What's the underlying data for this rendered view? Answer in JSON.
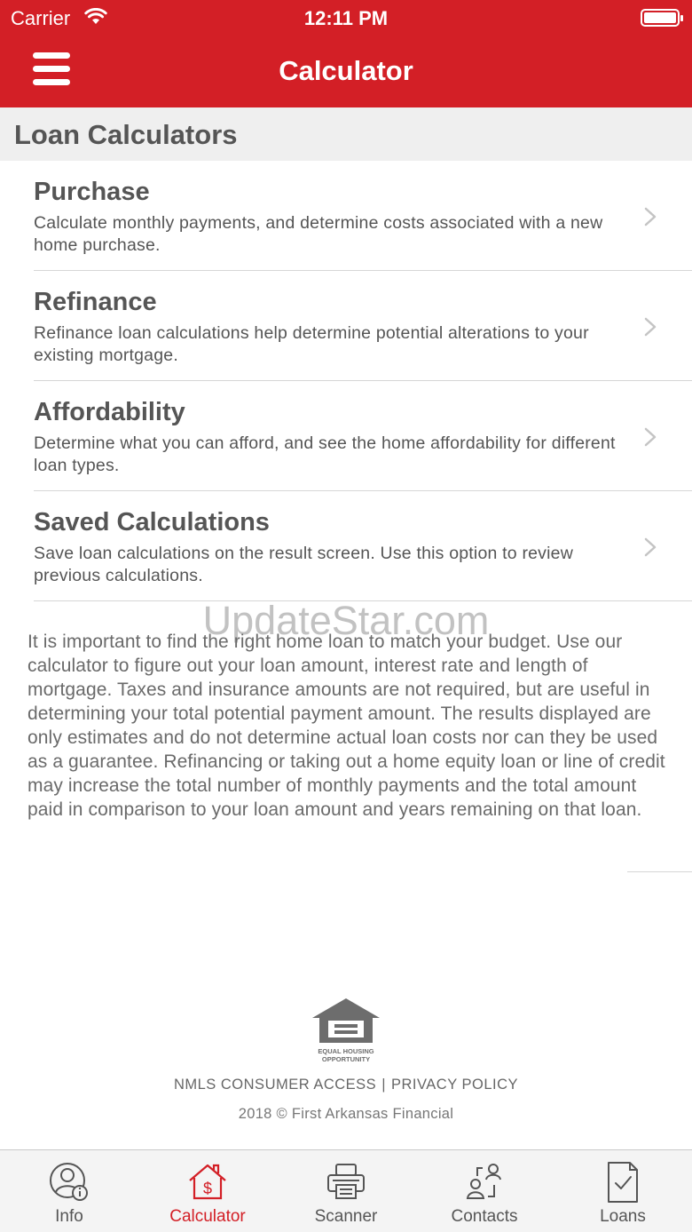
{
  "status_bar": {
    "carrier": "Carrier",
    "time": "12:11 PM"
  },
  "nav": {
    "title": "Calculator"
  },
  "section": {
    "header": "Loan Calculators"
  },
  "menu": {
    "items": [
      {
        "title": "Purchase",
        "description": "Calculate monthly payments, and determine costs associated with a new home purchase."
      },
      {
        "title": "Refinance",
        "description": "Refinance loan calculations help determine potential alterations to your existing mortgage."
      },
      {
        "title": "Affordability",
        "description": "Determine what you can afford, and see the home affordability for different loan types."
      },
      {
        "title": "Saved Calculations",
        "description": "Save loan calculations on the result screen. Use this option to review previous calculations."
      }
    ]
  },
  "watermark": "UpdateStar.com",
  "disclaimer": "It is important to find the right home loan to match your budget. Use our calculator to figure out your loan amount, interest rate and length of mortgage.  Taxes and insurance amounts are not required, but are useful in determining your total potential payment amount. The results displayed are only estimates and do not determine actual loan costs nor can they be used as a guarantee.  Refinancing or taking out a home equity loan  or line of credit may increase the total number of monthly payments and the total amount paid in comparison to your loan amount and years remaining on that loan.",
  "footer": {
    "logo_line1": "EQUAL HOUSING",
    "logo_line2": "OPPORTUNITY",
    "nmls": "NMLS CONSUMER ACCESS",
    "separator": "|",
    "privacy": "PRIVACY POLICY",
    "copyright": "2018 © First Arkansas Financial"
  },
  "tabs": [
    {
      "label": "Info",
      "icon": "info-person-icon",
      "active": false
    },
    {
      "label": "Calculator",
      "icon": "house-dollar-icon",
      "active": true
    },
    {
      "label": "Scanner",
      "icon": "printer-icon",
      "active": false
    },
    {
      "label": "Contacts",
      "icon": "contacts-icon",
      "active": false
    },
    {
      "label": "Loans",
      "icon": "document-check-icon",
      "active": false
    }
  ],
  "colors": {
    "brand_red": "#d31f26",
    "text_gray": "#555555",
    "header_bg": "#efefef"
  }
}
